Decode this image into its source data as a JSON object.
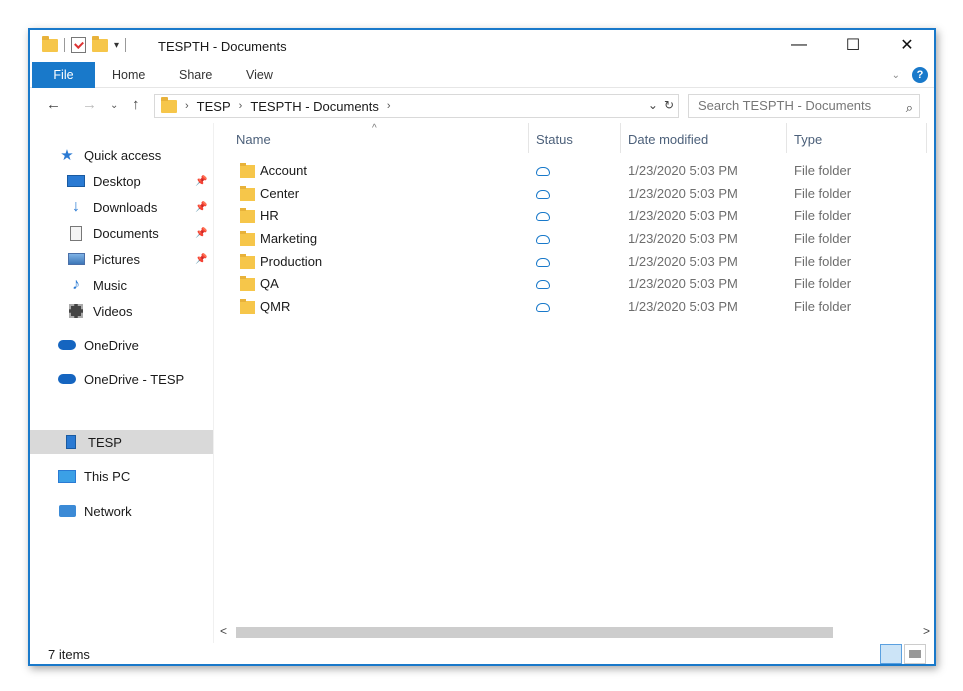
{
  "window": {
    "title": "TESPTH - Documents",
    "controls": {
      "minimize": "—",
      "maximize": "☐",
      "close": "✕"
    }
  },
  "quick_access_toolbar": {
    "caret": "▾"
  },
  "ribbon": {
    "tabs": [
      "File",
      "Home",
      "Share",
      "View"
    ],
    "collapse": "⌄",
    "help": "?"
  },
  "address": {
    "back": "←",
    "forward": "→",
    "recent": "⌄",
    "up": "↑",
    "crumbs": [
      "TESP",
      "TESPTH - Documents"
    ],
    "crumb_separator": "›",
    "dropdown": "⌄",
    "refresh": "↻",
    "search_placeholder": "Search TESPTH - Documents",
    "search_icon": "⌕"
  },
  "nav_pane": {
    "pin": "📌",
    "items": [
      {
        "label": "Quick access",
        "icon": "quick-access-star-icon"
      },
      {
        "label": "Desktop",
        "icon": "desktop-icon",
        "pinned": true
      },
      {
        "label": "Downloads",
        "icon": "downloads-icon",
        "pinned": true
      },
      {
        "label": "Documents",
        "icon": "documents-icon",
        "pinned": true
      },
      {
        "label": "Pictures",
        "icon": "pictures-icon",
        "pinned": true
      },
      {
        "label": "Music",
        "icon": "music-icon"
      },
      {
        "label": "Videos",
        "icon": "videos-icon"
      },
      {
        "label": "OneDrive",
        "icon": "onedrive-cloud-icon"
      },
      {
        "label": "OneDrive - TESP",
        "icon": "onedrive-business-cloud-icon"
      },
      {
        "label": "TESP",
        "icon": "sharepoint-building-icon",
        "selected": true
      },
      {
        "label": "This PC",
        "icon": "this-pc-icon"
      },
      {
        "label": "Network",
        "icon": "network-icon"
      }
    ]
  },
  "file_list": {
    "columns": {
      "name": "Name",
      "status": "Status",
      "date": "Date modified",
      "type": "Type"
    },
    "sort_indicator": "^",
    "rows": [
      {
        "name": "Account",
        "date": "1/23/2020 5:03 PM",
        "type": "File folder"
      },
      {
        "name": "Center",
        "date": "1/23/2020 5:03 PM",
        "type": "File folder"
      },
      {
        "name": "HR",
        "date": "1/23/2020 5:03 PM",
        "type": "File folder"
      },
      {
        "name": "Marketing",
        "date": "1/23/2020 5:03 PM",
        "type": "File folder"
      },
      {
        "name": "Production",
        "date": "1/23/2020 5:03 PM",
        "type": "File folder"
      },
      {
        "name": "QA",
        "date": "1/23/2020 5:03 PM",
        "type": "File folder"
      },
      {
        "name": "QMR",
        "date": "1/23/2020 5:03 PM",
        "type": "File folder"
      }
    ]
  },
  "scrollbar": {
    "left": "<",
    "right": ">"
  },
  "status_bar": {
    "item_count": "7 items"
  },
  "colors": {
    "accent": "#1979ca",
    "selected_nav": "#d9d9d9",
    "folder": "#f6c64a"
  }
}
